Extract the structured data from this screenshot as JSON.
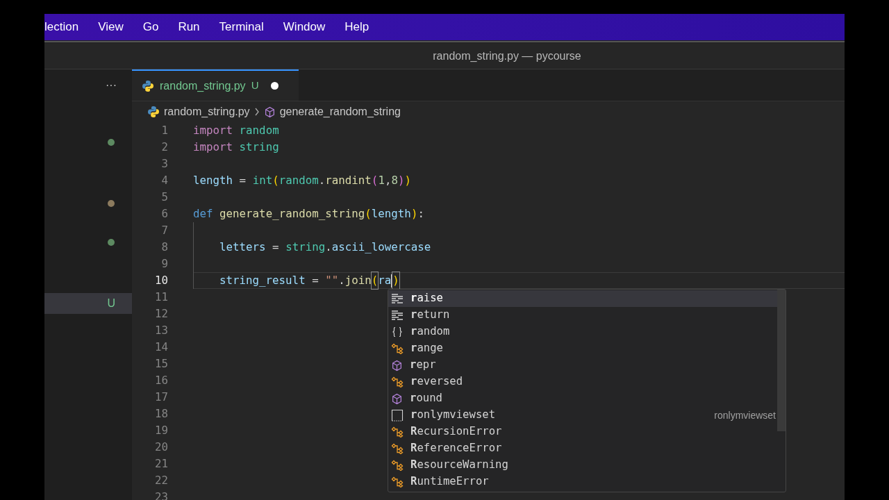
{
  "menu_bar": {
    "items": [
      "lection",
      "View",
      "Go",
      "Run",
      "Terminal",
      "Window",
      "Help"
    ]
  },
  "window": {
    "title": "random_string.py — pycourse"
  },
  "sidebar": {
    "more": "···",
    "markers": [
      {
        "color": "#5d8a61"
      },
      {
        "color": "#8c7b5e"
      },
      {
        "color": "#5d8a61"
      }
    ],
    "selected_row": {
      "status": "U",
      "selected": true
    }
  },
  "tabs": [
    {
      "label": "random_string.py",
      "status": "U",
      "dirty": true,
      "selected": true
    }
  ],
  "breadcrumb": {
    "file": "random_string.py",
    "symbol": "generate_random_string"
  },
  "code": [
    {
      "number": "1",
      "tokens": [
        {
          "kind": "keyword",
          "text": "import"
        },
        {
          "kind": "module",
          "text": " random"
        }
      ]
    },
    {
      "number": "2",
      "tokens": [
        {
          "kind": "keyword",
          "text": "import"
        },
        {
          "kind": "module",
          "text": " string"
        }
      ]
    },
    {
      "number": "3"
    },
    {
      "number": "4",
      "tokens": [
        {
          "kind": "variable",
          "text": "length"
        },
        {
          "kind": "plain",
          "text": " = "
        },
        {
          "kind": "module",
          "text": "int"
        },
        {
          "kind": "bracket",
          "text": "("
        },
        {
          "kind": "module",
          "text": "random"
        },
        {
          "kind": "plain",
          "text": "."
        },
        {
          "kind": "function",
          "text": "randint"
        },
        {
          "kind": "bracket2",
          "text": "("
        },
        {
          "kind": "number",
          "text": "1"
        },
        {
          "kind": "plain",
          "text": ","
        },
        {
          "kind": "number",
          "text": "8"
        },
        {
          "kind": "bracket2",
          "text": ")"
        },
        {
          "kind": "bracket",
          "text": ")"
        }
      ]
    },
    {
      "number": "5"
    },
    {
      "number": "6",
      "tokens": [
        {
          "kind": "def",
          "text": "def"
        },
        {
          "kind": "function",
          "text": " generate_random_string"
        },
        {
          "kind": "bracket",
          "text": "("
        },
        {
          "kind": "param",
          "text": "length"
        },
        {
          "kind": "bracket",
          "text": ")"
        },
        {
          "kind": "plain",
          "text": ":"
        }
      ]
    },
    {
      "number": "7",
      "indent": true
    },
    {
      "number": "8",
      "indent": true,
      "tokens": [
        {
          "kind": "variable",
          "text": "letters"
        },
        {
          "kind": "plain",
          "text": " = "
        },
        {
          "kind": "module",
          "text": "string"
        },
        {
          "kind": "plain",
          "text": "."
        },
        {
          "kind": "variable",
          "text": "ascii_lowercase"
        }
      ]
    },
    {
      "number": "9",
      "indent": true
    },
    {
      "number": "10",
      "indent": true,
      "active": true,
      "tokens": [
        {
          "kind": "variable",
          "text": "string_result"
        },
        {
          "kind": "plain",
          "text": " = "
        },
        {
          "kind": "string",
          "text": "\"\""
        },
        {
          "kind": "plain",
          "text": "."
        },
        {
          "kind": "function",
          "text": "join"
        },
        {
          "kind": "bracket",
          "text": "(",
          "matched": true
        },
        {
          "kind": "variable",
          "text": "ra",
          "cursor": true
        },
        {
          "kind": "bracket",
          "text": ")",
          "matched": true
        }
      ]
    },
    {
      "number": "11"
    },
    {
      "number": "12"
    },
    {
      "number": "13"
    },
    {
      "number": "14"
    },
    {
      "number": "15"
    },
    {
      "number": "16"
    },
    {
      "number": "17"
    },
    {
      "number": "18"
    },
    {
      "number": "19"
    },
    {
      "number": "20"
    },
    {
      "number": "21"
    },
    {
      "number": "22"
    },
    {
      "number": "23"
    }
  ],
  "suggestions": [
    {
      "kind": "keyword",
      "label": "**r**aise",
      "selected": true
    },
    {
      "kind": "keyword",
      "label": "**r**eturn",
      "selected": false
    },
    {
      "kind": "module",
      "label": "**r**andom",
      "selected": false
    },
    {
      "kind": "class",
      "label": "**r**ange",
      "selected": false
    },
    {
      "kind": "function",
      "label": "**r**epr",
      "selected": false
    },
    {
      "kind": "class",
      "label": "**r**eversed",
      "selected": false
    },
    {
      "kind": "function",
      "label": "**r**ound",
      "selected": false
    },
    {
      "kind": "text",
      "label": "**r**onlymviewset",
      "detail": "ronlymviewset",
      "selected": false
    },
    {
      "kind": "class",
      "label": "**R**ecursionError",
      "selected": false
    },
    {
      "kind": "class",
      "label": "**R**eferenceError",
      "selected": false
    },
    {
      "kind": "class",
      "label": "**R**esourceWarning",
      "selected": false
    },
    {
      "kind": "class",
      "label": "**R**untimeError",
      "selected": false
    }
  ]
}
